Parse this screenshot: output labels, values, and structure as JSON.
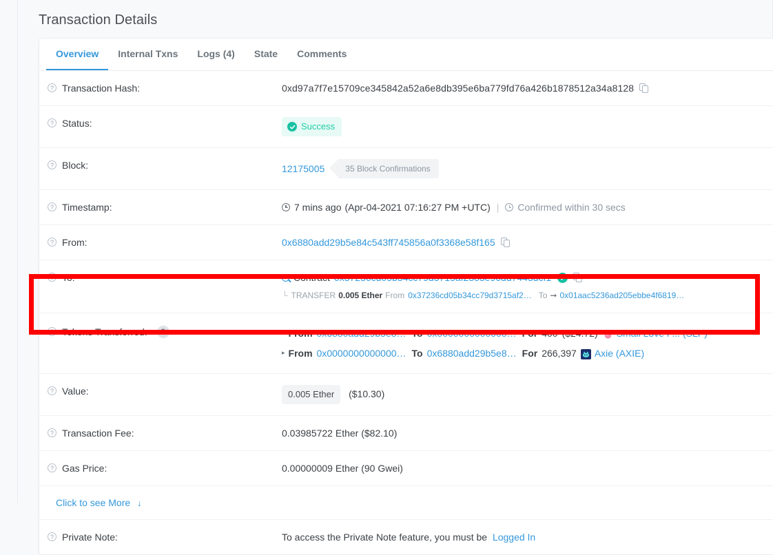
{
  "page": {
    "title": "Transaction Details"
  },
  "tabs": [
    {
      "label": "Overview",
      "active": true
    },
    {
      "label": "Internal Txns",
      "active": false
    },
    {
      "label": "Logs (4)",
      "active": false
    },
    {
      "label": "State",
      "active": false
    },
    {
      "label": "Comments",
      "active": false
    }
  ],
  "rows": {
    "transaction_hash": {
      "label": "Transaction Hash:",
      "value": "0xd97a7f7e15709ce345842a52a6e8db395e6ba779fd76a426b1878512a34a8128",
      "copy_icon": "copy-icon"
    },
    "status": {
      "label": "Status:",
      "badge": "Success",
      "badge_bg": "#e7faf5",
      "badge_fg": "#21ceaa"
    },
    "block": {
      "label": "Block:",
      "number": "12175005",
      "confirmations": "35 Block Confirmations"
    },
    "timestamp": {
      "label": "Timestamp:",
      "relative": "7 mins ago",
      "absolute": "(Apr-04-2021 07:16:27 PM +UTC)",
      "separator": "|",
      "confirmed": "Confirmed within 30 secs"
    },
    "from": {
      "label": "From:",
      "address": "0x6880add29b5e84c543ff745856a0f3368e58f165"
    },
    "to": {
      "label": "To:",
      "contract_word": "Contract",
      "address": "0x37236cd05b34cc79d3715af2383e96dd7443dcf1",
      "verified_icon": "verified-check-icon",
      "internal": {
        "corner": "└",
        "type": "TRANSFER",
        "amount": "0.005 Ether",
        "from_word": "From",
        "from_address": "0x37236cd05b34cc79d3715af2…",
        "to_word": "To",
        "to_address": "0x01aac5236ad205ebbe4f6819…"
      }
    },
    "tokens_transferred": {
      "label": "Tokens Transferred:",
      "count": "2",
      "items": [
        {
          "from_word": "From",
          "from_address": "0x6880add29b5e8…",
          "to_word": "To",
          "to_address": "0x0000000000000…",
          "for_word": "For",
          "amount": "400",
          "usd": "($24.72)",
          "token_name": "Small Love P... (SLP)",
          "token_icon": "slp-potion-icon",
          "token_color": "#f48fb1"
        },
        {
          "from_word": "From",
          "from_address": "0x0000000000000…",
          "to_word": "To",
          "to_address": "0x6880add29b5e8…",
          "for_word": "For",
          "amount": "266,397",
          "usd": "",
          "token_name": "Axie (AXIE)",
          "token_icon": "axie-icon",
          "token_color": "#1b2f6b"
        }
      ]
    },
    "value": {
      "label": "Value:",
      "pill": "0.005 Ether",
      "usd": "($10.30)"
    },
    "transaction_fee": {
      "label": "Transaction Fee:",
      "value": "0.03985722 Ether ($82.10)"
    },
    "gas_price": {
      "label": "Gas Price:",
      "value": "0.00000009 Ether (90 Gwei)"
    },
    "see_more": {
      "label": "Click to see More",
      "arrow": "↓"
    },
    "private_note": {
      "label": "Private Note:",
      "text": "To access the Private Note feature, you must be",
      "link": "Logged In"
    }
  },
  "annotation": {
    "box_color": "#ff0000",
    "target": "tokens-transferred-row"
  }
}
